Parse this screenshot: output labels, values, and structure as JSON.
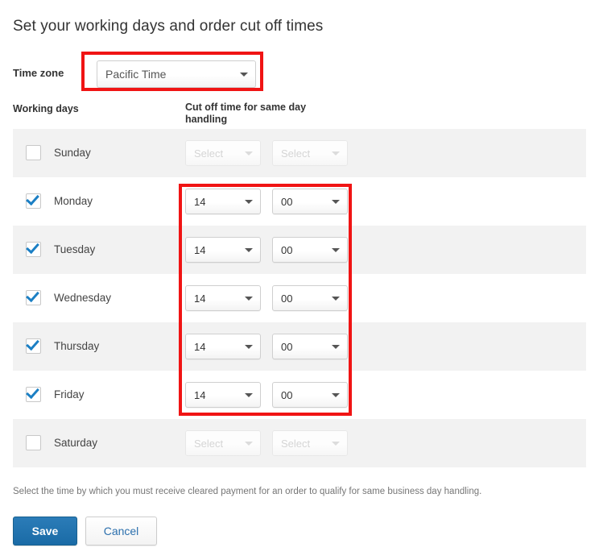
{
  "page_title": "Set your working days and order cut off times",
  "timezone": {
    "label": "Time zone",
    "selected": "Pacific Time",
    "caret_icon": "chevron-down-icon"
  },
  "columns": {
    "working_days": "Working days",
    "cut_off": "Cut off time for same day handling"
  },
  "placeholder": "Select",
  "rows": [
    {
      "day": "Sunday",
      "checked": false,
      "hours": "Select",
      "minutes": "Select",
      "enabled": false,
      "striped": true
    },
    {
      "day": "Monday",
      "checked": true,
      "hours": "14",
      "minutes": "00",
      "enabled": true,
      "striped": false
    },
    {
      "day": "Tuesday",
      "checked": true,
      "hours": "14",
      "minutes": "00",
      "enabled": true,
      "striped": true
    },
    {
      "day": "Wednesday",
      "checked": true,
      "hours": "14",
      "minutes": "00",
      "enabled": true,
      "striped": false
    },
    {
      "day": "Thursday",
      "checked": true,
      "hours": "14",
      "minutes": "00",
      "enabled": true,
      "striped": true
    },
    {
      "day": "Friday",
      "checked": true,
      "hours": "14",
      "minutes": "00",
      "enabled": true,
      "striped": false
    },
    {
      "day": "Saturday",
      "checked": false,
      "hours": "Select",
      "minutes": "Select",
      "enabled": false,
      "striped": true
    }
  ],
  "help_text": "Select the time by which you must receive cleared payment for an order to qualify for same business day handling.",
  "buttons": {
    "save": "Save",
    "cancel": "Cancel"
  },
  "annotations": {
    "highlight_color": "#f01414",
    "boxes": [
      {
        "name": "timezone-highlight"
      },
      {
        "name": "cutoff-times-highlight"
      }
    ]
  },
  "colors": {
    "accent_blue": "#1a6ba6",
    "check_blue": "#1b7fc4",
    "row_stripe": "#f2f2f2",
    "text": "#333333"
  }
}
